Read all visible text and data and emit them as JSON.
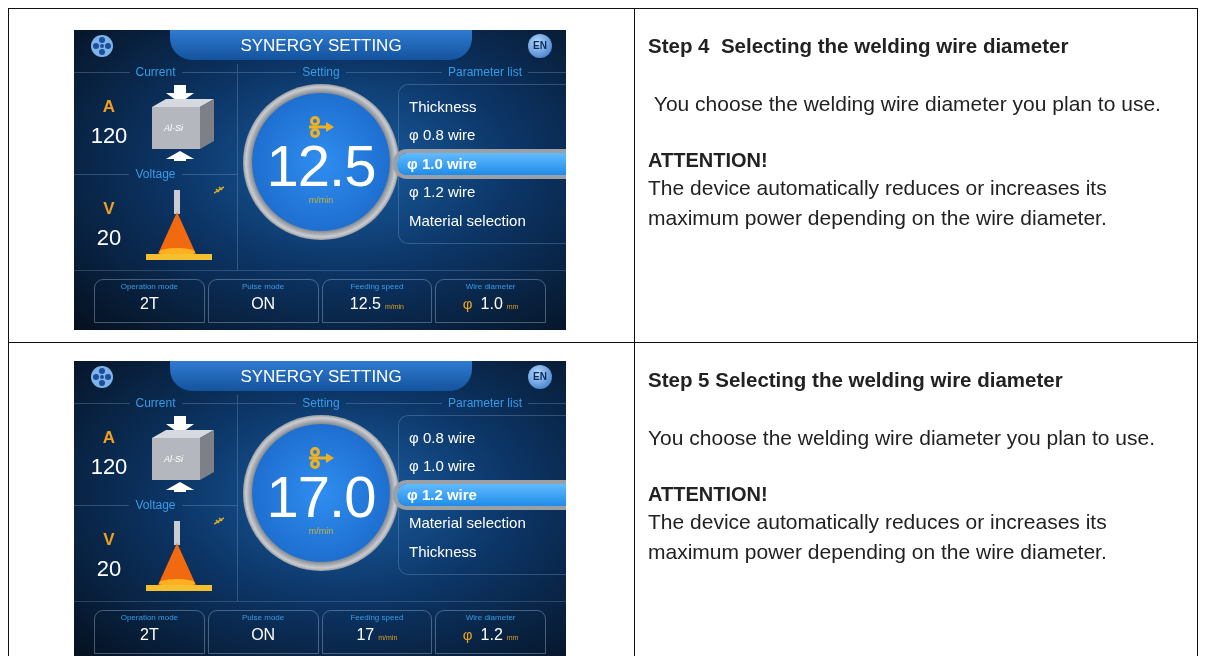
{
  "rows": [
    {
      "screen": {
        "title": "SYNERGY SETTING",
        "language": "EN",
        "current": {
          "label": "Current",
          "unit": "A",
          "value": "120",
          "material": "Al-Si"
        },
        "voltage": {
          "label": "Voltage",
          "unit": "V",
          "value": "20"
        },
        "setting": {
          "label": "Setting",
          "value": "12.5",
          "unit": "m/min"
        },
        "parameter_list": {
          "label": "Parameter list",
          "items": [
            {
              "label": "Thickness",
              "selected": false
            },
            {
              "label": "φ 0.8 wire",
              "selected": false
            },
            {
              "label": "φ 1.0 wire",
              "selected": true
            },
            {
              "label": "φ 1.2 wire",
              "selected": false
            },
            {
              "label": "Material selection",
              "selected": false
            }
          ]
        },
        "status": [
          {
            "label": "Operation mode",
            "value": "2T"
          },
          {
            "label": "Pulse mode",
            "value": "ON"
          },
          {
            "label": "Feeding speed",
            "value": "12.5",
            "unit": "m/min"
          },
          {
            "label": "Wire diameter",
            "prefix": "φ",
            "value": "1.0",
            "unit": "mm"
          }
        ]
      },
      "step": {
        "title": "Step 4  Selecting the welding wire diameter",
        "text": " You choose the welding wire diameter you plan to use.",
        "attention_title": "ATTENTION!",
        "attention_text": "The device automatically reduces or increases its maximum power depending on the wire diameter."
      }
    },
    {
      "screen": {
        "title": "SYNERGY SETTING",
        "language": "EN",
        "current": {
          "label": "Current",
          "unit": "A",
          "value": "120",
          "material": "Al-Si"
        },
        "voltage": {
          "label": "Voltage",
          "unit": "V",
          "value": "20"
        },
        "setting": {
          "label": "Setting",
          "value": "17.0",
          "unit": "m/min"
        },
        "parameter_list": {
          "label": "Parameter list",
          "items": [
            {
              "label": "φ 0.8 wire",
              "selected": false
            },
            {
              "label": "φ 1.0 wire",
              "selected": false
            },
            {
              "label": "φ 1.2 wire",
              "selected": true
            },
            {
              "label": "Material selection",
              "selected": false
            },
            {
              "label": "Thickness",
              "selected": false
            }
          ]
        },
        "status": [
          {
            "label": "Operation mode",
            "value": "2T"
          },
          {
            "label": "Pulse mode",
            "value": "ON"
          },
          {
            "label": "Feeding speed",
            "value": "17",
            "unit": "m/min"
          },
          {
            "label": "Wire diameter",
            "prefix": "φ",
            "value": "1.2",
            "unit": "mm"
          }
        ]
      },
      "step": {
        "title": "Step 5 Selecting the welding wire diameter",
        "text": "You choose the welding wire diameter you plan to use.",
        "attention_title": "ATTENTION!",
        "attention_text": "The device automatically reduces or increases its maximum power depending on the wire diameter."
      }
    }
  ]
}
